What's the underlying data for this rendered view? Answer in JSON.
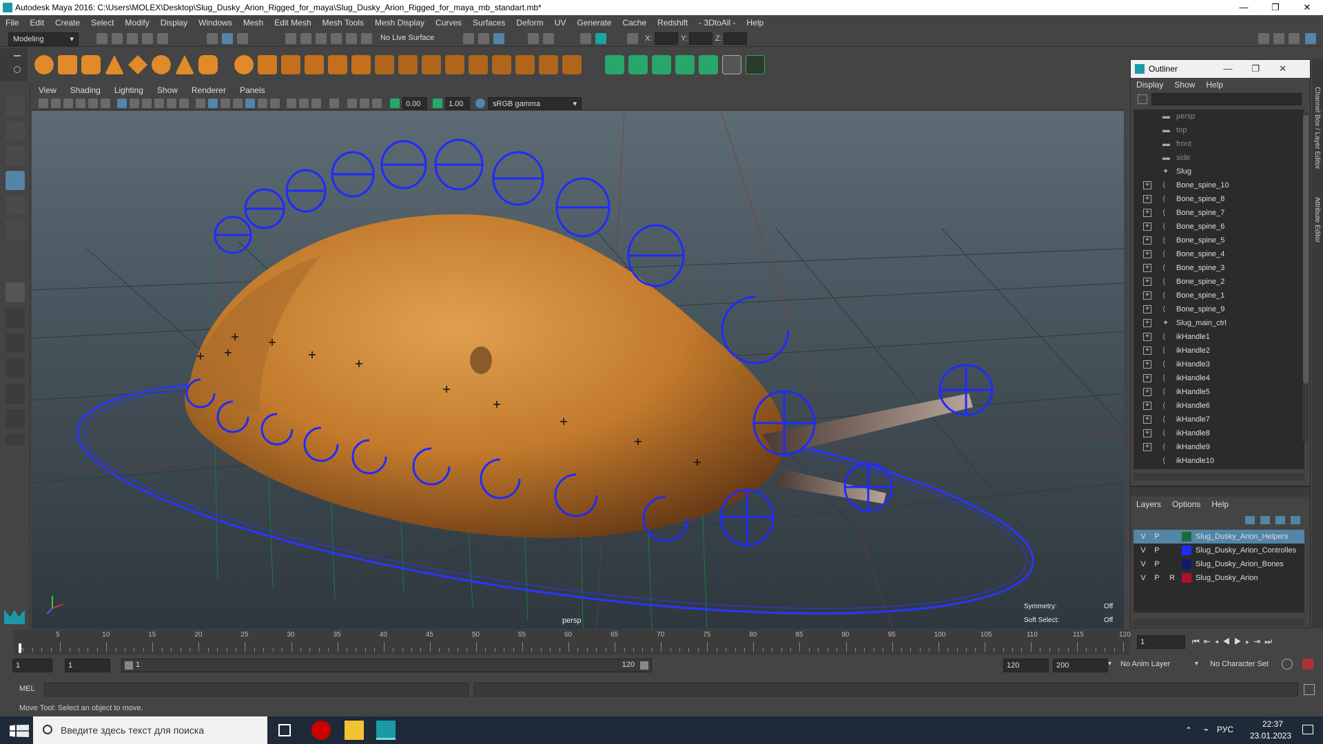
{
  "window": {
    "title": "Autodesk Maya 2016: C:\\Users\\MOLEX\\Desktop\\Slug_Dusky_Arion_Rigged_for_maya\\Slug_Dusky_Arion_Rigged_for_maya_mb_standart.mb*",
    "minimize": "—",
    "maximize": "❐",
    "close": "✕"
  },
  "menubar": [
    "File",
    "Edit",
    "Create",
    "Select",
    "Modify",
    "Display",
    "Windows",
    "Mesh",
    "Edit Mesh",
    "Mesh Tools",
    "Mesh Display",
    "Curves",
    "Surfaces",
    "Deform",
    "UV",
    "Generate",
    "Cache",
    "Redshift",
    "- 3DtoAll -",
    "Help"
  ],
  "statusline": {
    "mode": "Modeling",
    "live_surface": "No Live Surface",
    "x_label": "X:",
    "y_label": "Y:",
    "z_label": "Z:"
  },
  "viewport": {
    "menu": [
      "View",
      "Shading",
      "Lighting",
      "Show",
      "Renderer",
      "Panels"
    ],
    "exposure": "0.00",
    "gamma": "1.00",
    "color_space": "sRGB gamma",
    "camera_label": "persp",
    "symmetry_label": "Symmetry:",
    "symmetry_value": "Off",
    "soft_select_label": "Soft Select:",
    "soft_select_value": "Off"
  },
  "outliner": {
    "title": "Outliner",
    "menu": [
      "Display",
      "Show",
      "Help"
    ],
    "items": [
      {
        "label": "persp",
        "dim": true,
        "expand": false,
        "icon": "camera-icon"
      },
      {
        "label": "top",
        "dim": true,
        "expand": false,
        "icon": "camera-icon"
      },
      {
        "label": "front",
        "dim": true,
        "expand": false,
        "icon": "camera-icon"
      },
      {
        "label": "side",
        "dim": true,
        "expand": false,
        "icon": "camera-icon"
      },
      {
        "label": "Slug",
        "dim": false,
        "expand": false,
        "icon": "mesh-icon"
      },
      {
        "label": "Bone_spine_10",
        "dim": false,
        "expand": true,
        "icon": "joint-icon"
      },
      {
        "label": "Bone_spine_8",
        "dim": false,
        "expand": true,
        "icon": "joint-icon"
      },
      {
        "label": "Bone_spine_7",
        "dim": false,
        "expand": true,
        "icon": "joint-icon"
      },
      {
        "label": "Bone_spine_6",
        "dim": false,
        "expand": true,
        "icon": "joint-icon"
      },
      {
        "label": "Bone_spine_5",
        "dim": false,
        "expand": true,
        "icon": "joint-icon"
      },
      {
        "label": "Bone_spine_4",
        "dim": false,
        "expand": true,
        "icon": "joint-icon"
      },
      {
        "label": "Bone_spine_3",
        "dim": false,
        "expand": true,
        "icon": "joint-icon"
      },
      {
        "label": "Bone_spine_2",
        "dim": false,
        "expand": true,
        "icon": "joint-icon"
      },
      {
        "label": "Bone_spine_1",
        "dim": false,
        "expand": true,
        "icon": "joint-icon"
      },
      {
        "label": "Bone_spine_9",
        "dim": false,
        "expand": true,
        "icon": "joint-icon"
      },
      {
        "label": "Slug_main_ctrl",
        "dim": false,
        "expand": true,
        "icon": "curve-icon"
      },
      {
        "label": "ikHandle1",
        "dim": false,
        "expand": true,
        "icon": "ik-handle-icon"
      },
      {
        "label": "ikHandle2",
        "dim": false,
        "expand": true,
        "icon": "ik-handle-icon"
      },
      {
        "label": "ikHandle3",
        "dim": false,
        "expand": true,
        "icon": "ik-handle-icon"
      },
      {
        "label": "ikHandle4",
        "dim": false,
        "expand": true,
        "icon": "ik-handle-icon"
      },
      {
        "label": "ikHandle5",
        "dim": false,
        "expand": true,
        "icon": "ik-handle-icon"
      },
      {
        "label": "ikHandle6",
        "dim": false,
        "expand": true,
        "icon": "ik-handle-icon"
      },
      {
        "label": "ikHandle7",
        "dim": false,
        "expand": true,
        "icon": "ik-handle-icon"
      },
      {
        "label": "ikHandle8",
        "dim": false,
        "expand": true,
        "icon": "ik-handle-icon"
      },
      {
        "label": "ikHandle9",
        "dim": false,
        "expand": true,
        "icon": "ik-handle-icon"
      },
      {
        "label": "ikHandle10",
        "dim": false,
        "expand": false,
        "icon": "ik-handle-icon"
      }
    ]
  },
  "layers": {
    "menu": [
      "Layers",
      "Options",
      "Help"
    ],
    "rows": [
      {
        "v": "V",
        "p": "P",
        "r": "",
        "color": "#1a6b3a",
        "name": "Slug_Dusky_Arion_Helpers",
        "selected": true
      },
      {
        "v": "V",
        "p": "P",
        "r": "",
        "color": "#1f2bff",
        "name": "Slug_Dusky_Arion_Controlles",
        "selected": false
      },
      {
        "v": "V",
        "p": "P",
        "r": "",
        "color": "#101a6e",
        "name": "Slug_Dusky_Arion_Bones",
        "selected": false
      },
      {
        "v": "V",
        "p": "P",
        "r": "R",
        "color": "#b0102a",
        "name": "Slug_Dusky_Arion",
        "selected": false
      }
    ]
  },
  "sidetabs": {
    "channel_box": "Channel Box / Layer Editor",
    "attribute_editor": "Attribute Editor"
  },
  "timeslider": {
    "ticks": [
      "5",
      "10",
      "15",
      "20",
      "25",
      "30",
      "35",
      "40",
      "45",
      "50",
      "55",
      "60",
      "65",
      "70",
      "75",
      "80",
      "85",
      "90",
      "95",
      "100",
      "105",
      "110",
      "115",
      "120"
    ],
    "start_mark": "1",
    "current_frame": "1"
  },
  "rangeslider": {
    "start": "1",
    "playback_start": "1",
    "range_start": "1",
    "range_end": "120",
    "playback_end": "120",
    "end": "200",
    "anim_layer": "No Anim Layer",
    "character_set": "No Character Set"
  },
  "cmdline": {
    "label": "MEL"
  },
  "helpline": {
    "text": "Move Tool: Select an object to move."
  },
  "taskbar": {
    "search_placeholder": "Введите здесь текст для поиска",
    "lang": "РУС",
    "time": "22:37",
    "date": "23.01.2023"
  }
}
